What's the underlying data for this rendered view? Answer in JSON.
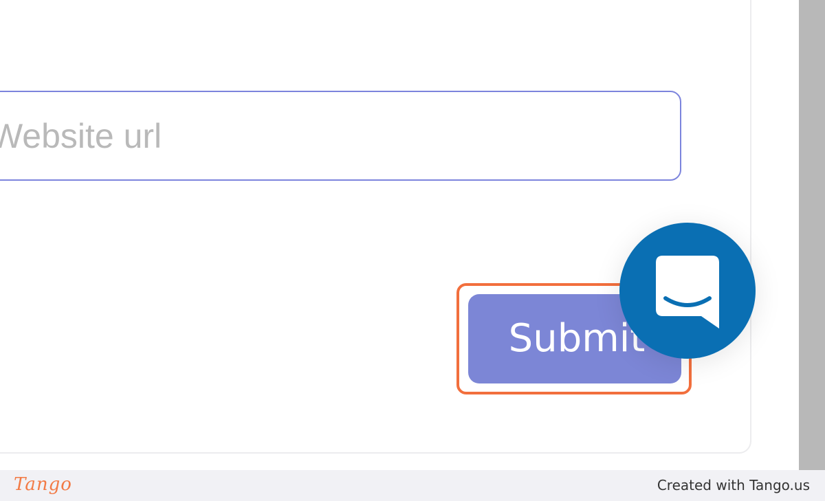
{
  "form": {
    "url_input": {
      "value": "",
      "placeholder": "Website url"
    },
    "submit_label": "Submit"
  },
  "chat_widget": {
    "icon": "chat-bubble-smile-icon",
    "color": "#0a6fb3"
  },
  "highlight": {
    "target": "submit-button",
    "color": "#f26f3d"
  },
  "colors": {
    "accent": "#7c86d6",
    "input_border": "#7c84dd"
  },
  "footer": {
    "logo_text": "Tango",
    "credit": "Created with Tango.us"
  }
}
